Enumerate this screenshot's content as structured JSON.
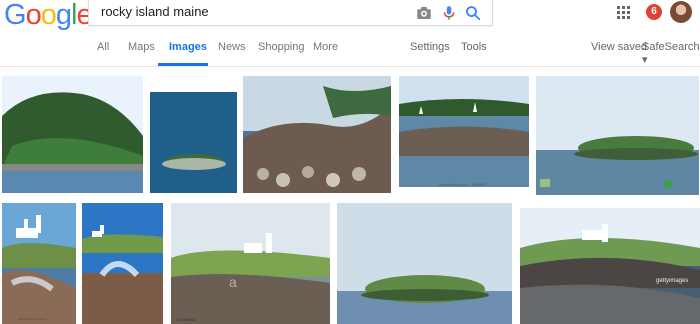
{
  "logo": {
    "letters": [
      "G",
      "o",
      "o",
      "g",
      "l",
      "e"
    ],
    "colors": [
      "#4285f4",
      "#ea4335",
      "#fbbc05",
      "#4285f4",
      "#34a853",
      "#ea4335"
    ]
  },
  "search": {
    "query": "rocky island maine"
  },
  "tabs": [
    "All",
    "Maps",
    "Images",
    "News",
    "Shopping",
    "More"
  ],
  "right_links": [
    "Settings",
    "Tools"
  ],
  "right_tools": {
    "view_saved": "View saved",
    "safe_search": "SafeSearch"
  },
  "notifications": {
    "count": "6"
  },
  "images": {
    "captions": [
      "www.alamy.com - JWR99Y",
      "BX0RW6E",
      "www.alamy.com - AT6 K06"
    ],
    "watermark_alamy": "a",
    "gettyimages": "gettyimages"
  }
}
